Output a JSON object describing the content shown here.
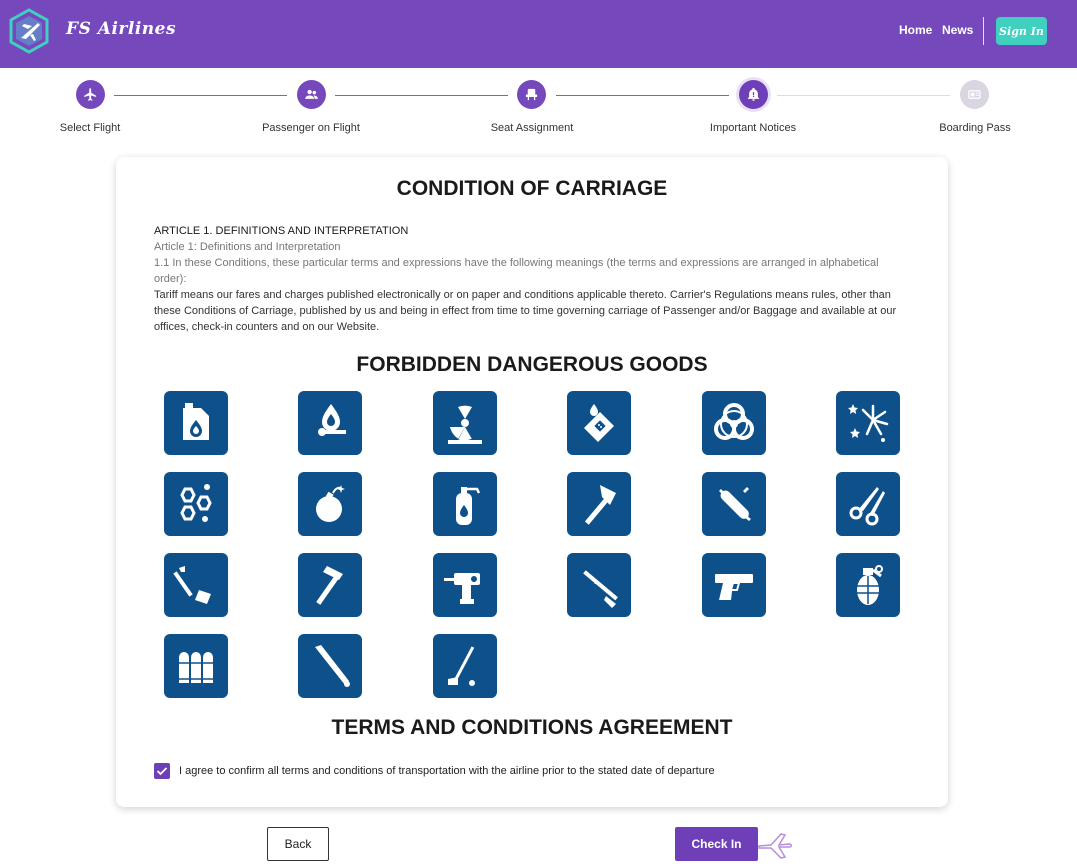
{
  "header": {
    "brand": "FS Airlines",
    "nav": {
      "home": "Home",
      "news": "News",
      "sign_in": "Sign In"
    },
    "colors": {
      "bar": "#7548bb",
      "sign_in": "#3fd0c0"
    }
  },
  "stepper": {
    "steps": [
      {
        "label": "Select Flight",
        "icon": "airplane-icon",
        "state": "completed"
      },
      {
        "label": "Passenger on Flight",
        "icon": "people-icon",
        "state": "completed"
      },
      {
        "label": "Seat Assignment",
        "icon": "seat-icon",
        "state": "completed"
      },
      {
        "label": "Important Notices",
        "icon": "bell-icon",
        "state": "active"
      },
      {
        "label": "Boarding Pass",
        "icon": "ticket-icon",
        "state": "disabled"
      }
    ]
  },
  "card": {
    "carriage_title": "CONDITION OF CARRIAGE",
    "article_heading": "ARTICLE 1. DEFINITIONS AND INTERPRETATION",
    "article_sub": "Article 1: Definitions and Interpretation",
    "article_intro": "1.1 In these Conditions, these particular terms and expressions have the following meanings (the terms and expressions are arranged in alphabetical order):",
    "article_body": "Tariff means our fares and charges published electronically or on paper and conditions applicable thereto. Carrier's Regulations means rules, other than these Conditions of Carriage, published by us and being in effect from time to time governing carriage of Passenger and/or Baggage and available at our offices, check-in counters and on our Website.",
    "forbidden_title": "FORBIDDEN DANGEROUS GOODS",
    "forbidden_icons": [
      "fuel-can-icon",
      "flame-match-icon",
      "radiation-icon",
      "lighter-icon",
      "biohazard-icon",
      "fireworks-icon",
      "chemical-icon",
      "bomb-icon",
      "fire-extinguisher-icon",
      "axe-icon",
      "multitool-knife-icon",
      "scissors-icon",
      "shovel-icon",
      "hammer-icon",
      "power-drill-icon",
      "rifle-icon",
      "pistol-icon",
      "grenade-icon",
      "bullets-icon",
      "baseball-bat-icon",
      "golf-club-icon"
    ],
    "terms_title": "TERMS AND CONDITIONS AGREEMENT",
    "agree_text": "I agree to confirm all terms and conditions of transportation with the airline prior to the stated date of departure",
    "agree_checked": true,
    "tile_color": "#0e5089"
  },
  "actions": {
    "back": "Back",
    "check_in": "Check In",
    "accent": "#6e3fb6"
  }
}
